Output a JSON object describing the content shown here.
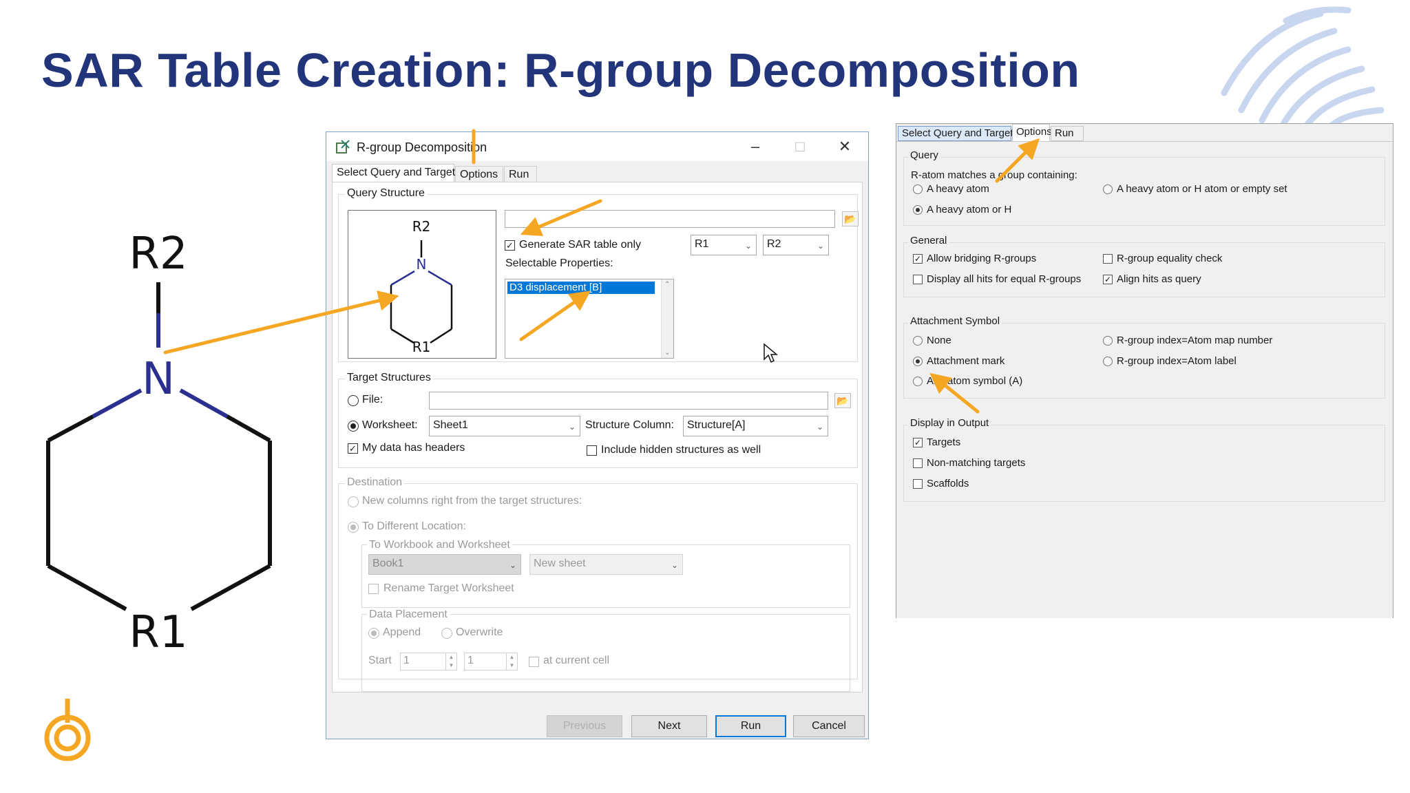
{
  "slide": {
    "title": "SAR Table Creation: R-group Decomposition"
  },
  "molecule": {
    "top_label": "R2",
    "nitrogen": "N",
    "bottom_label": "R1"
  },
  "colors": {
    "title": "#23357a",
    "arrow": "#f5a623",
    "bond_nitrogen": "#2b2f8f",
    "logo": "#f5a623",
    "deco": "#c9d6ef"
  },
  "dialog": {
    "title": "R-group Decomposition",
    "tabs": [
      "Select Query and Target",
      "Options",
      "Run"
    ],
    "query_structure": {
      "group_label": "Query Structure",
      "preview": {
        "top_label": "R2",
        "nitrogen": "N",
        "bottom_label": "R1"
      },
      "path_value": "",
      "generate_sar_label": "Generate SAR table only",
      "generate_sar_checked": true,
      "selectable_properties_label": "Selectable Properties:",
      "selected_property": "D3 displacement [B]",
      "r1_select": "R1",
      "r2_select": "R2"
    },
    "target_structures": {
      "group_label": "Target Structures",
      "file_label": "File:",
      "file_value": "",
      "worksheet_label": "Worksheet:",
      "worksheet_value": "Sheet1",
      "structure_column_label": "Structure Column:",
      "structure_column_value": "Structure[A]",
      "headers_label": "My data has headers",
      "headers_checked": true,
      "hidden_label": "Include hidden structures as well",
      "hidden_checked": false
    },
    "destination": {
      "group_label": "Destination",
      "new_columns_label": "New columns right from the target structures:",
      "different_location_label": "To Different Location:",
      "workbook_group_label": "To Workbook and Worksheet",
      "workbook_value": "Book1",
      "sheet_value": "New sheet",
      "rename_label": "Rename Target Worksheet",
      "placement_group_label": "Data Placement",
      "append_label": "Append",
      "overwrite_label": "Overwrite",
      "start_label": "Start",
      "start_row": "1",
      "start_col": "1",
      "current_cell_label": "at current cell"
    },
    "buttons": {
      "previous": "Previous",
      "next": "Next",
      "run": "Run",
      "cancel": "Cancel"
    }
  },
  "options_panel": {
    "tabs": [
      "Select Query and Target",
      "Options",
      "Run"
    ],
    "query": {
      "group_label": "Query",
      "rule_label": "R-atom matches a group containing:",
      "opt_heavy": "A heavy atom",
      "opt_heavy_or_h_or_empty": "A heavy atom or H atom or empty set",
      "opt_heavy_or_h": "A heavy atom or H",
      "selected": "A heavy atom or H"
    },
    "general": {
      "group_label": "General",
      "allow_bridging": "Allow bridging R-groups",
      "allow_bridging_checked": true,
      "equality_check": "R-group equality check",
      "equality_check_checked": false,
      "display_all_hits": "Display all hits for equal R-groups",
      "display_all_hits_checked": false,
      "align_hits": "Align hits as query",
      "align_hits_checked": true
    },
    "attachment": {
      "group_label": "Attachment Symbol",
      "none": "None",
      "map_number": "R-group index=Atom map number",
      "attachment_mark": "Attachment mark",
      "atom_label": "R-group index=Atom label",
      "any_atom": "Any atom symbol (A)",
      "selected": "Attachment mark"
    },
    "display": {
      "group_label": "Display in Output",
      "targets": "Targets",
      "targets_checked": true,
      "non_matching": "Non-matching targets",
      "non_matching_checked": false,
      "scaffolds": "Scaffolds",
      "scaffolds_checked": false
    }
  }
}
